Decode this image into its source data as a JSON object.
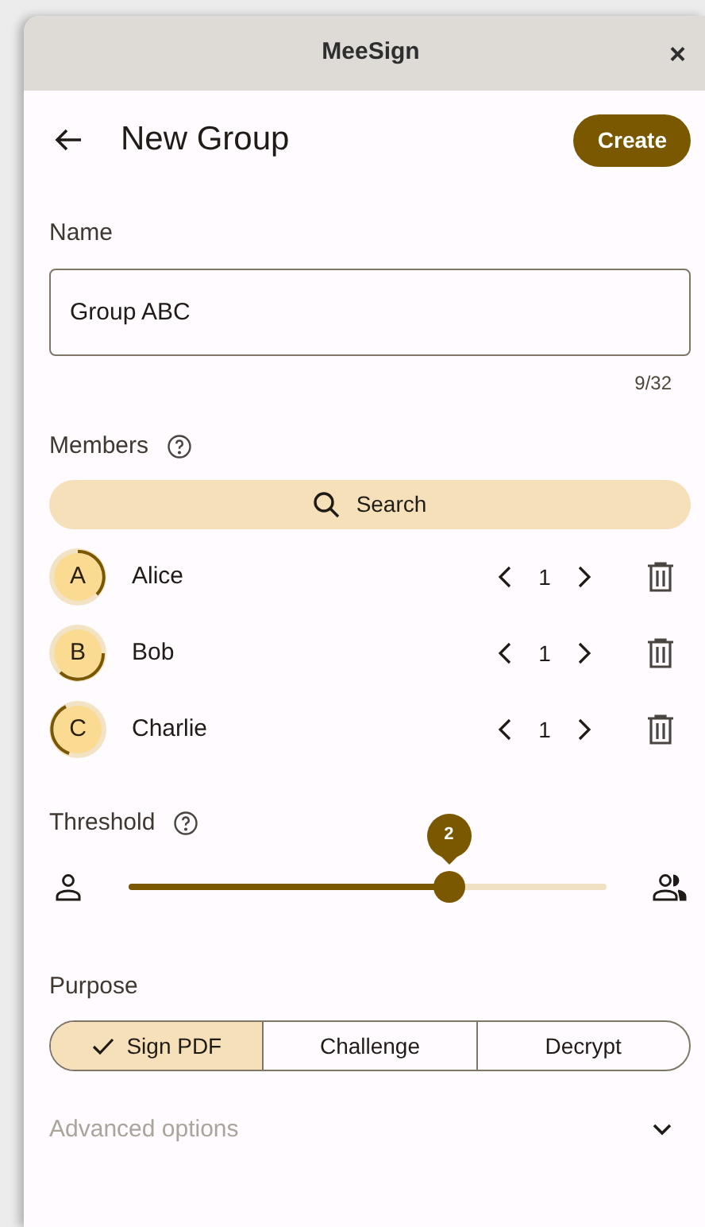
{
  "window": {
    "title": "MeeSign",
    "close": "×"
  },
  "header": {
    "title": "New Group",
    "action": "Create"
  },
  "name_field": {
    "label": "Name",
    "value": "Group ABC",
    "counter": "9/32"
  },
  "members": {
    "label": "Members",
    "search": "Search",
    "items": [
      {
        "initial": "A",
        "name": "Alice",
        "count": "1"
      },
      {
        "initial": "B",
        "name": "Bob",
        "count": "1"
      },
      {
        "initial": "C",
        "name": "Charlie",
        "count": "1"
      }
    ]
  },
  "threshold": {
    "label": "Threshold",
    "value": "2",
    "level": 0.67
  },
  "purpose": {
    "label": "Purpose",
    "options": [
      {
        "label": "Sign PDF",
        "selected": true
      },
      {
        "label": "Challenge",
        "selected": false
      },
      {
        "label": "Decrypt",
        "selected": false
      }
    ]
  },
  "advanced": {
    "label": "Advanced options",
    "expanded": false
  }
}
